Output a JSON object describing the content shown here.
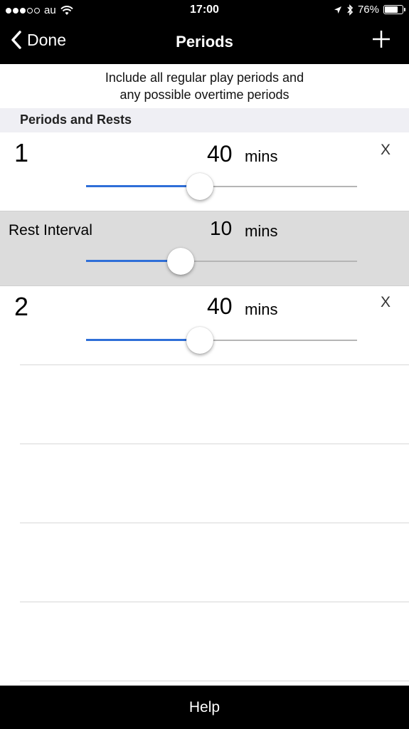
{
  "status_bar": {
    "carrier": "au",
    "time": "17:00",
    "battery_percent": "76%",
    "battery_level": 0.76,
    "signal_bars_filled": 3,
    "signal_bars_total": 5
  },
  "nav": {
    "back_label": "Done",
    "title": "Periods",
    "add_icon": "plus-icon"
  },
  "info_text": {
    "line1": "Include all regular play periods and",
    "line2": "any possible overtime periods"
  },
  "section_header": "Periods and Rests",
  "rows": [
    {
      "kind": "period",
      "label": "1",
      "value": "40",
      "unit": "mins",
      "delete_label": "X",
      "slider_fraction": 0.42
    },
    {
      "kind": "rest",
      "label": "Rest Interval",
      "value": "10",
      "unit": "mins",
      "slider_fraction": 0.35
    },
    {
      "kind": "period",
      "label": "2",
      "value": "40",
      "unit": "mins",
      "delete_label": "X",
      "slider_fraction": 0.42
    }
  ],
  "accent_color": "#2f6fd8",
  "bottom_bar": {
    "label": "Help"
  }
}
